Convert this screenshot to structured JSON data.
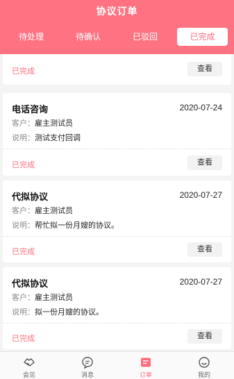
{
  "header": {
    "title": "协议订单",
    "tabs": [
      "待处理",
      "待确认",
      "已驳回",
      "已完成"
    ],
    "active_tab": 3,
    "color": "#ff7282"
  },
  "cards": [
    {
      "status": "已完成",
      "view": "查看"
    },
    {
      "title": "电话咨询",
      "date": "2020-07-24",
      "client_label": "客户：",
      "client": "雇主测试员",
      "desc_label": "说明：",
      "desc": "测试支付回调",
      "status": "已完成",
      "view": "查看"
    },
    {
      "title": "代拟协议",
      "date": "2020-07-27",
      "client_label": "客户：",
      "client": "雇主测试员",
      "desc_label": "说明：",
      "desc": "帮忙拟一份月嫂的协议。",
      "status": "已完成",
      "view": "查看"
    },
    {
      "title": "代拟协议",
      "date": "2020-07-27",
      "client_label": "客户：",
      "client": "雇主测试员",
      "desc_label": "说明：",
      "desc": "拟一份月嫂的协议。",
      "status": "已完成",
      "view": "查看"
    }
  ],
  "nav": [
    {
      "label": "会见",
      "icon": "handshake-icon"
    },
    {
      "label": "消息",
      "icon": "message-icon"
    },
    {
      "label": "订单",
      "icon": "order-icon"
    },
    {
      "label": "我的",
      "icon": "profile-icon"
    }
  ],
  "active_nav": 2,
  "accent_color": "#ff6d7e"
}
